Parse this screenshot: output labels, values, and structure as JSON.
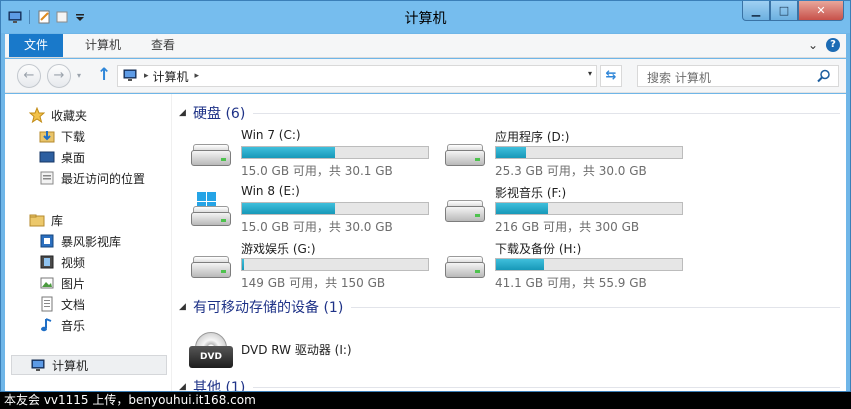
{
  "window": {
    "title": "计算机"
  },
  "titlebar": {
    "min": "▁",
    "max": "□",
    "close": "✕"
  },
  "ribbon": {
    "tabs": [
      {
        "label": "文件"
      },
      {
        "label": "计算机"
      },
      {
        "label": "查看"
      }
    ],
    "expand": "⌄",
    "help": "?"
  },
  "nav": {
    "back": "←",
    "forward": "→",
    "history": "▾",
    "up": "↑",
    "chevron": "▸",
    "address": "计算机",
    "address_dropdown": "▾",
    "refresh": "⇆",
    "search_placeholder": "搜索 计算机"
  },
  "sidebar": {
    "favorites": {
      "label": "收藏夹"
    },
    "favorites_items": [
      {
        "label": "下载"
      },
      {
        "label": "桌面"
      },
      {
        "label": "最近访问的位置"
      }
    ],
    "libraries": {
      "label": "库"
    },
    "libraries_items": [
      {
        "label": "暴风影视库"
      },
      {
        "label": "视频"
      },
      {
        "label": "图片"
      },
      {
        "label": "文档"
      },
      {
        "label": "音乐"
      }
    ],
    "computer": {
      "label": "计算机"
    }
  },
  "main": {
    "groups": [
      {
        "label": "硬盘 (6)",
        "arrow": "◢"
      },
      {
        "label": "有可移动存储的设备 (1)",
        "arrow": "◢"
      },
      {
        "label": "其他 (1)",
        "arrow": "◢"
      }
    ],
    "drives": [
      {
        "name": "Win 7 (C:)",
        "info": "15.0 GB 可用，共 30.1 GB",
        "used_fraction": 0.5,
        "icon": "hard-drive-icon"
      },
      {
        "name": "应用程序 (D:)",
        "info": "25.3 GB 可用，共 30.0 GB",
        "used_fraction": 0.16,
        "icon": "hard-drive-icon"
      },
      {
        "name": "Win 8 (E:)",
        "info": "15.0 GB 可用，共 30.0 GB",
        "used_fraction": 0.5,
        "icon": "windows-drive-icon"
      },
      {
        "name": "影视音乐 (F:)",
        "info": "216 GB 可用，共 300 GB",
        "used_fraction": 0.28,
        "icon": "hard-drive-icon"
      },
      {
        "name": "游戏娱乐 (G:)",
        "info": "149 GB 可用，共 150 GB",
        "used_fraction": 0.01,
        "icon": "hard-drive-icon"
      },
      {
        "name": "下载及备份 (H:)",
        "info": "41.1 GB 可用，共 55.9 GB",
        "used_fraction": 0.26,
        "icon": "hard-drive-icon"
      }
    ],
    "removable": [
      {
        "name": "DVD RW 驱动器 (I:)",
        "icon_text": "DVD"
      }
    ]
  },
  "watermark": "本友会 vv1115 上传，benyouhui.it168.com",
  "colors": {
    "accent": "#1979ca",
    "bar_fill": "#26a9c9",
    "group_header": "#1e3287"
  }
}
